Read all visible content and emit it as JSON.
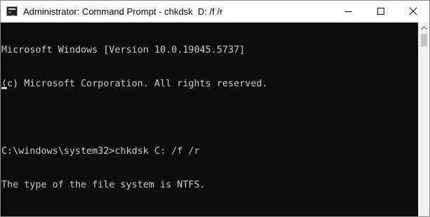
{
  "window": {
    "title": "Administrator: Command Prompt - chkdsk  D: /f /r",
    "app_icon": "cmd-icon",
    "controls": {
      "minimize_icon": "minimize-icon",
      "maximize_icon": "maximize-icon",
      "close_icon": "close-icon"
    }
  },
  "console": {
    "lines": [
      "Microsoft Windows [Version 10.0.19045.5737]",
      "(c) Microsoft Corporation. All rights reserved.",
      "",
      "C:\\windows\\system32>chkdsk C: /f /r",
      "The type of the file system is NTFS."
    ],
    "text_color": "#cccccc",
    "background_color": "#0c0c0c"
  },
  "scrollbar": {
    "up_arrow_icon": "chevron-up-icon"
  }
}
